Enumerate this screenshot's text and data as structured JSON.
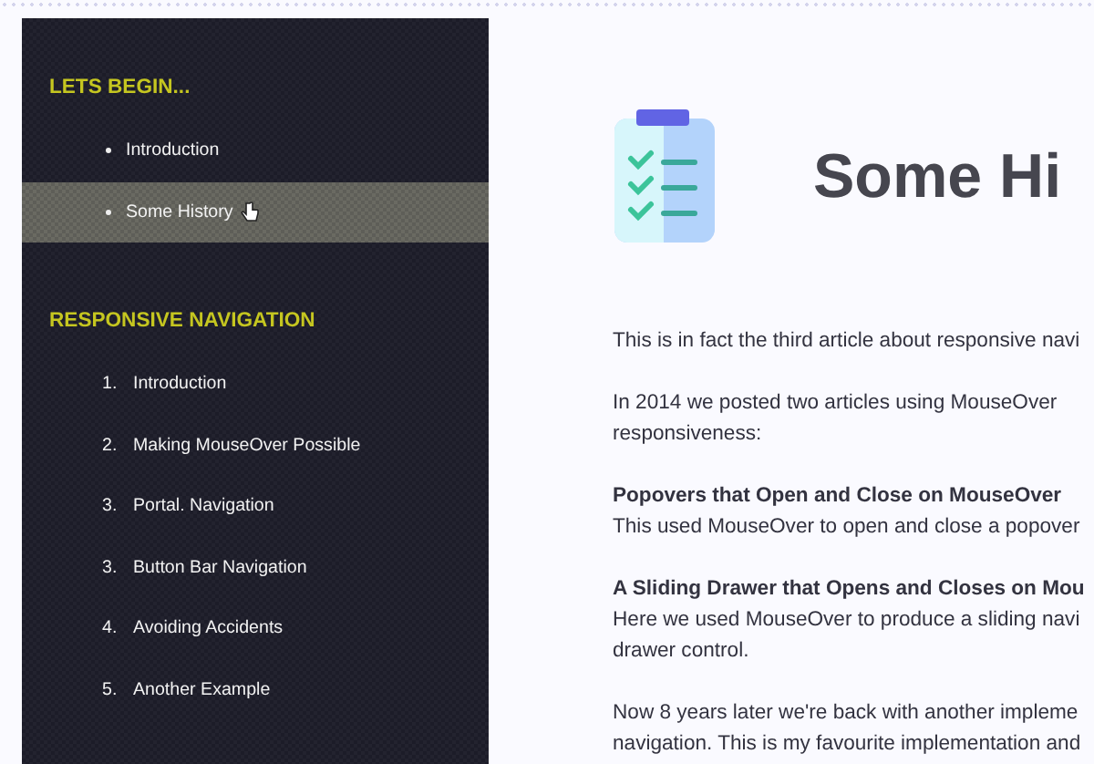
{
  "sidebar": {
    "sections": [
      {
        "heading": "LETS BEGIN...",
        "kind": "bulleted",
        "items": [
          {
            "label": "Introduction",
            "selected": false
          },
          {
            "label": "Some History",
            "selected": true
          }
        ]
      },
      {
        "heading": "RESPONSIVE NAVIGATION",
        "kind": "numbered",
        "items": [
          {
            "number": "1.",
            "label": "Introduction",
            "selected": false
          },
          {
            "number": "2.",
            "label": "Making MouseOver Possible",
            "selected": false
          },
          {
            "number": "3.",
            "label": "Portal. Navigation",
            "selected": false
          },
          {
            "number": "3.",
            "label": "Button Bar Navigation",
            "selected": false
          },
          {
            "number": "4.",
            "label": "Avoiding Accidents",
            "selected": false
          },
          {
            "number": "5.",
            "label": "Another Example",
            "selected": false
          }
        ]
      }
    ]
  },
  "article": {
    "title": "Some Hi",
    "blocks": [
      {
        "kind": "paragraph",
        "lines": [
          "This is in fact the third article about responsive navi"
        ]
      },
      {
        "kind": "paragraph",
        "lines": [
          "In 2014 we posted two articles using MouseOver",
          "responsiveness:"
        ]
      },
      {
        "kind": "reference",
        "title": "Popovers that Open and Close on MouseOver",
        "lines": [
          "This used MouseOver to open and close a popover"
        ]
      },
      {
        "kind": "reference",
        "title": "A Sliding Drawer that Opens and Closes on Mou",
        "lines": [
          "Here we used MouseOver to produce a sliding navi",
          "drawer control."
        ]
      },
      {
        "kind": "paragraph",
        "lines": [
          "Now 8 years later we're back with another impleme",
          "navigation.  This is my favourite implementation and"
        ]
      }
    ]
  }
}
